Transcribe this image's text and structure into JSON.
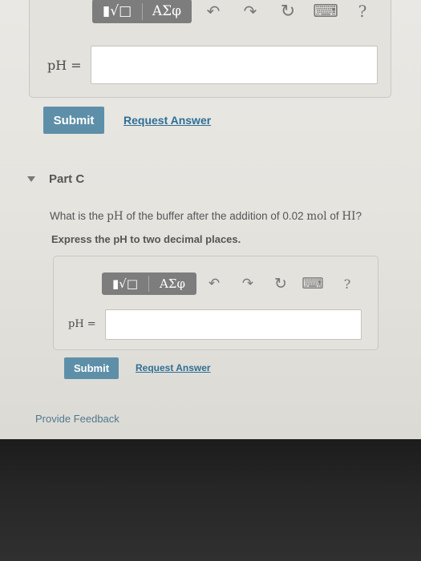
{
  "part_b": {
    "toolbar": {
      "template_glyph": "▮√□",
      "greek_glyph": "ΑΣφ",
      "undo_icon": "↶",
      "redo_icon": "↷",
      "reset_icon": "↻",
      "keyboard_icon": "⌨",
      "help_icon": "?"
    },
    "field_label": "pH =",
    "field_value": "",
    "submit_label": "Submit",
    "request_label": "Request Answer"
  },
  "part_c": {
    "title": "Part C",
    "question_prefix": "What is the ",
    "question_ph": "pH",
    "question_middle": " of the buffer after the addition of 0.02 ",
    "question_mol": "mol",
    "question_of": " of ",
    "question_hi": "HI",
    "question_suffix": "?",
    "instruction": "Express the pH to two decimal places.",
    "toolbar": {
      "template_glyph": "▮√□",
      "greek_glyph": "ΑΣφ",
      "undo_icon": "↶",
      "redo_icon": "↷",
      "reset_icon": "↻",
      "keyboard_icon": "⌨",
      "help_icon": "?"
    },
    "field_label": "pH =",
    "field_value": "",
    "submit_label": "Submit",
    "request_label": "Request Answer"
  },
  "feedback_label": "Provide Feedback",
  "colors": {
    "submit_bg": "#5e8fa9",
    "link": "#2f6f96",
    "toolbar_bg": "#7d7d7d"
  }
}
